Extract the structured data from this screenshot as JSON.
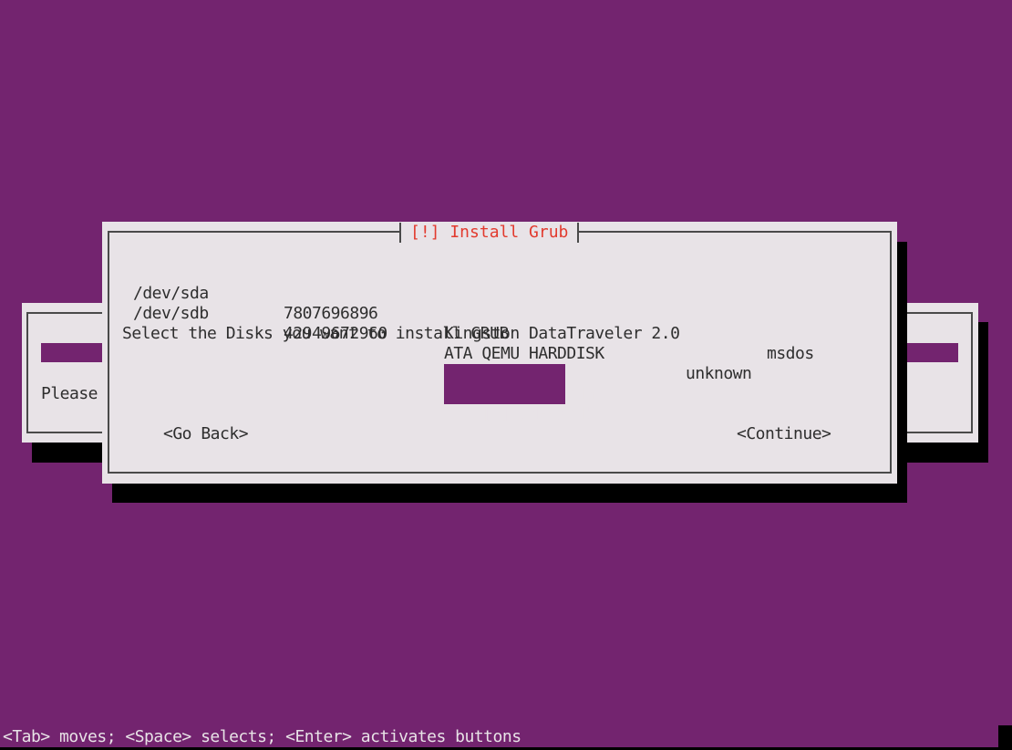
{
  "background_dialog": {
    "prompt_partial": "Please"
  },
  "dialog": {
    "title": "[!] Install Grub",
    "disks": [
      {
        "device": "/dev/sda",
        "size": "7807696896",
        "model": "Kingston DataTraveler 2.0",
        "partition_table": "msdos"
      },
      {
        "device": "/dev/sdb",
        "size": "42949672960",
        "model": "ATA QEMU HARDDISK",
        "partition_table": "unknown"
      }
    ],
    "question": "Select the Disks you want to install GRUB",
    "options": [
      {
        "checkbox": "*",
        "label": "/dev/sda",
        "checked": true,
        "focused": true
      },
      {
        "checkbox": "*",
        "label": "/dev/sdb",
        "checked": true,
        "focused": false
      }
    ],
    "go_back_label": "<Go Back>",
    "continue_label": "<Continue>"
  },
  "status_bar": {
    "help_text": "<Tab> moves; <Space> selects; <Enter> activates buttons"
  },
  "colors": {
    "background": "#73246f",
    "dialog": "#e8e3e7",
    "title": "#e23a2e",
    "cursor": "#e23a2e"
  }
}
